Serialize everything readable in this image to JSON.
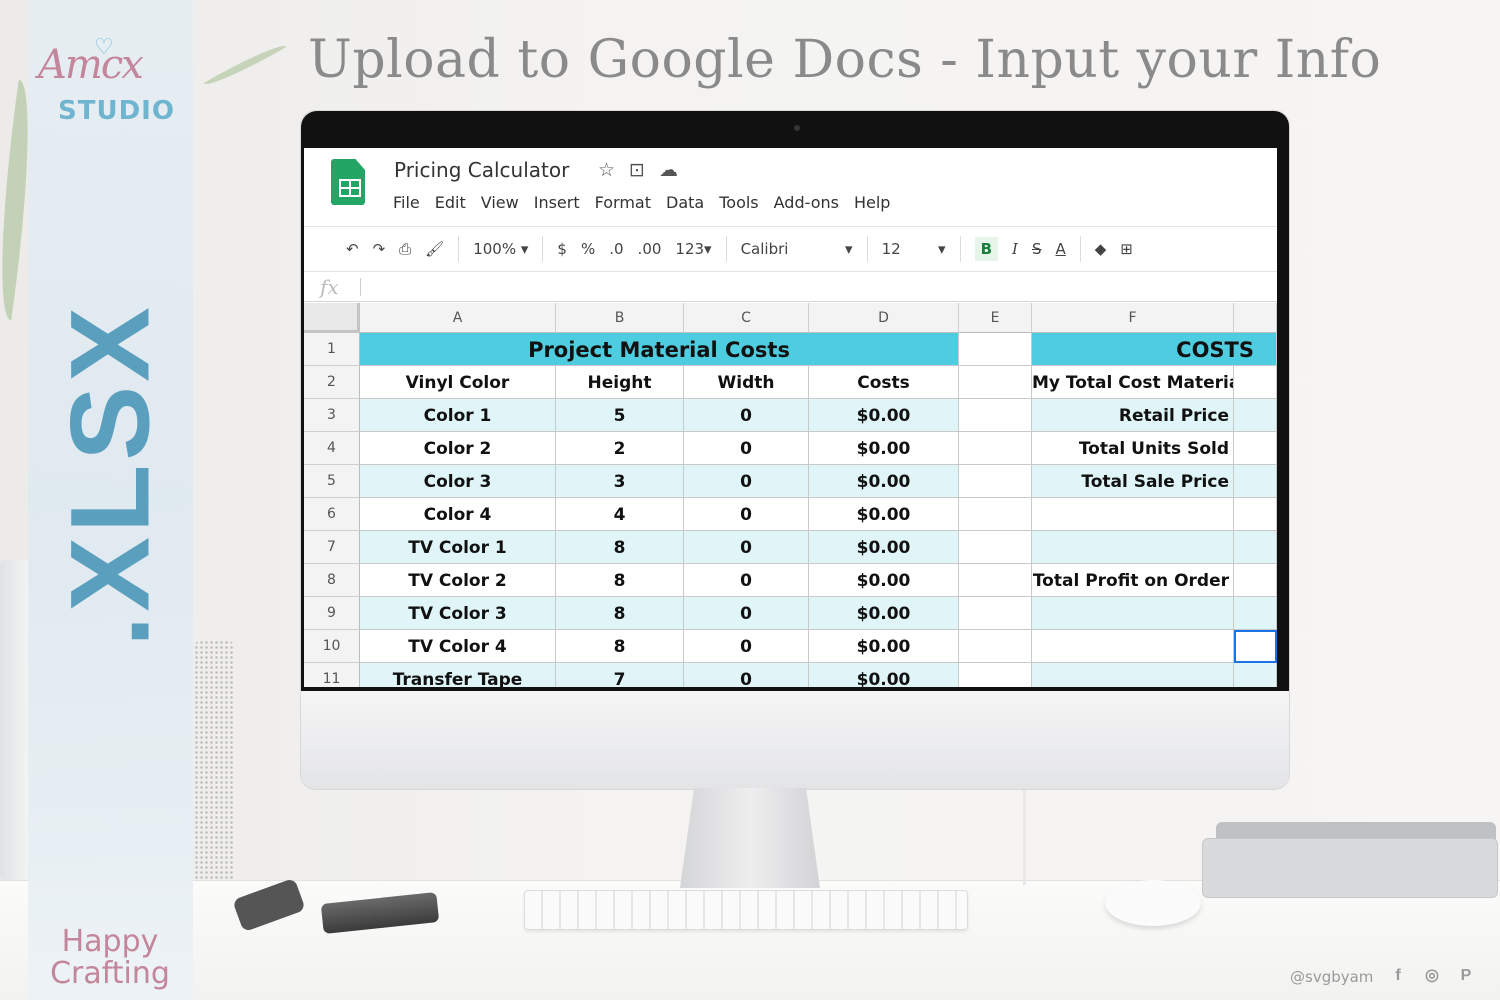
{
  "brand": {
    "script": "Amcx",
    "studio": "STUDIO"
  },
  "headline": "Upload to Google Docs - Input your Info",
  "side_label": ".XLSX",
  "tagline": [
    "Happy",
    "Crafting"
  ],
  "footer": {
    "handle": "@svgbyam",
    "social_icons": [
      "facebook-icon",
      "instagram-icon",
      "pinterest-icon"
    ]
  },
  "sheets": {
    "doc_title": "Pricing Calculator",
    "title_icons": [
      "star-icon",
      "move-folder-icon",
      "cloud-status-icon"
    ],
    "menu": [
      "File",
      "Edit",
      "View",
      "Insert",
      "Format",
      "Data",
      "Tools",
      "Add-ons",
      "Help"
    ],
    "toolbar": {
      "undo": "↶",
      "redo": "↷",
      "print": "⎙",
      "paint_format": "🖌",
      "zoom": "100%",
      "currency": "$",
      "percent": "%",
      "dec_decrease": ".0",
      "dec_increase": ".00",
      "more_formats": "123",
      "font": "Calibri",
      "font_size": "12",
      "bold": "B",
      "italic": "I",
      "strike": "S",
      "text_color": "A",
      "fill": "◆",
      "borders": "⊞"
    },
    "formula_label": "fx",
    "columns": [
      "A",
      "B",
      "C",
      "D",
      "E",
      "F"
    ],
    "rows": [
      "1",
      "2",
      "3",
      "4",
      "5",
      "6",
      "7",
      "8",
      "9",
      "10",
      "11"
    ],
    "table_title": "Project Material Costs",
    "table_headers": [
      "Vinyl Color",
      "Height",
      "Width",
      "Costs"
    ],
    "table_rows": [
      [
        "Color 1",
        "5",
        "0",
        "$0.00"
      ],
      [
        "Color 2",
        "2",
        "0",
        "$0.00"
      ],
      [
        "Color 3",
        "3",
        "0",
        "$0.00"
      ],
      [
        "Color 4",
        "4",
        "0",
        "$0.00"
      ],
      [
        "TV Color 1",
        "8",
        "0",
        "$0.00"
      ],
      [
        "TV Color 2",
        "8",
        "0",
        "$0.00"
      ],
      [
        "TV Color 3",
        "8",
        "0",
        "$0.00"
      ],
      [
        "TV Color 4",
        "8",
        "0",
        "$0.00"
      ],
      [
        "Transfer Tape",
        "7",
        "0",
        "$0.00"
      ]
    ],
    "costs_title": "COSTS",
    "costs_labels": [
      "My Total Cost Materials",
      "Retail Price",
      "Total Units Sold",
      "Total Sale Price",
      "",
      "",
      "Total Profit on Order",
      "",
      "",
      ""
    ],
    "colors": {
      "header_fill": "#4ecde0",
      "alt_row": "#dff5f8",
      "sheets_green": "#23a566"
    }
  }
}
